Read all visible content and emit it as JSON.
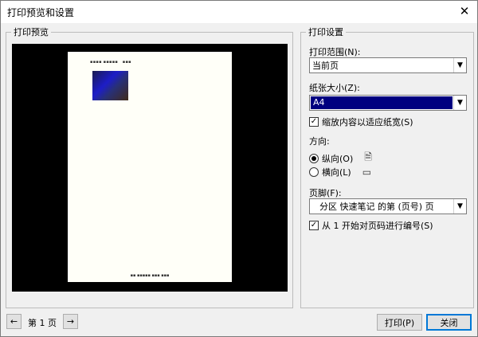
{
  "window": {
    "title": "打印预览和设置"
  },
  "preview": {
    "legend": "打印预览",
    "paper": {
      "header_text": "",
      "footer_text": ""
    }
  },
  "settings": {
    "legend": "打印设置",
    "print_range_label": "打印范围(N):",
    "print_range_value": "当前页",
    "paper_size_label": "纸张大小(Z):",
    "paper_size_value": "A4",
    "scale_label": "缩放内容以适应纸宽(S)",
    "scale_checked": true,
    "orientation_label": "方向:",
    "portrait_label": "纵向(O)",
    "landscape_label": "横向(L)",
    "orientation_selected": "portrait",
    "footer_label": "页脚(F):",
    "footer_value": "分区 快速笔记 的第 (页号) 页",
    "number_from_one_label": "从 1 开始对页码进行编号(S)",
    "number_from_one_checked": true
  },
  "navigation": {
    "page_label": "第 1 页",
    "prev_icon": "arrow-left-icon",
    "next_icon": "arrow-right-icon"
  },
  "buttons": {
    "print_label": "打印(P)",
    "cancel_label": "关闭"
  }
}
